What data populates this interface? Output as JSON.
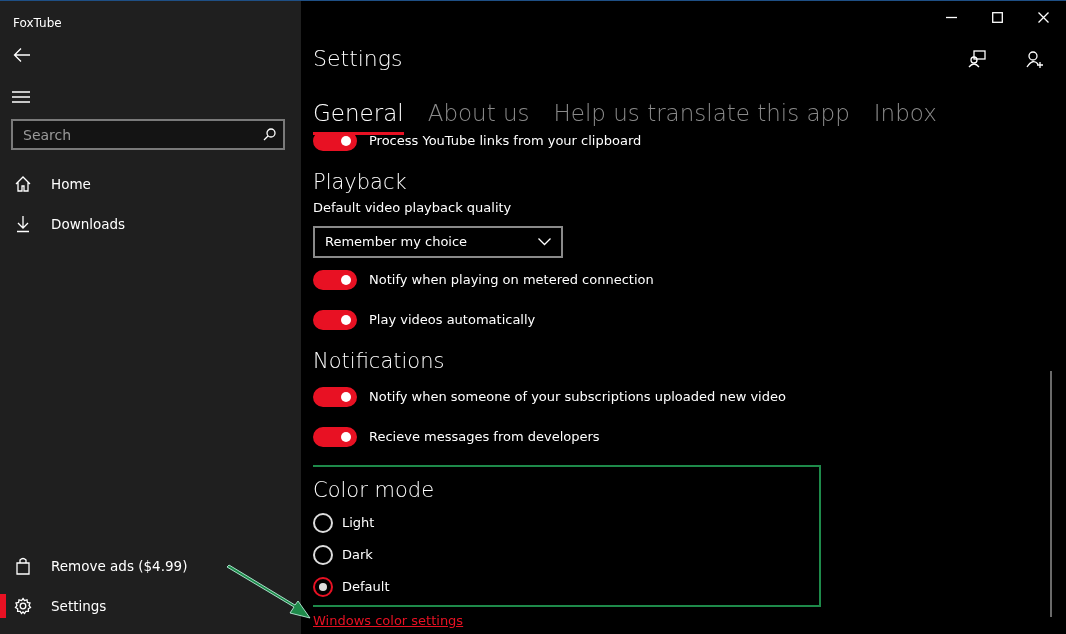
{
  "window": {
    "title": "FoxTube"
  },
  "sidebar": {
    "search": {
      "placeholder": "Search"
    },
    "items": [
      {
        "label": "Home",
        "selected": false
      },
      {
        "label": "Downloads",
        "selected": false
      }
    ],
    "footer_items": [
      {
        "label": "Remove ads ($4.99)",
        "selected": false
      },
      {
        "label": "Settings",
        "selected": true
      }
    ]
  },
  "page": {
    "title": "Settings",
    "tabs": [
      {
        "label": "General",
        "selected": true
      },
      {
        "label": "About us",
        "selected": false
      },
      {
        "label": "Help us translate this app",
        "selected": false
      },
      {
        "label": "Inbox",
        "selected": false
      }
    ],
    "top_toggle": {
      "label": "Process YouTube links from your clipboard",
      "on": true
    },
    "sections": [
      {
        "title": "Playback",
        "items": [
          {
            "kind": "dropdown",
            "label": "Default video playback quality",
            "value": "Remember my choice"
          },
          {
            "kind": "toggle",
            "label": "Notify when playing on metered connection",
            "on": true
          },
          {
            "kind": "toggle",
            "label": "Play videos automatically",
            "on": true
          }
        ]
      },
      {
        "title": "Notifications",
        "items": [
          {
            "kind": "toggle",
            "label": "Notify when someone of your subscriptions uploaded new video",
            "on": true
          },
          {
            "kind": "toggle",
            "label": "Recieve messages from developers",
            "on": true
          }
        ]
      },
      {
        "title": "Color mode",
        "highlighted": true,
        "items": [
          {
            "kind": "radio",
            "label": "Light",
            "selected": false
          },
          {
            "kind": "radio",
            "label": "Dark",
            "selected": false
          },
          {
            "kind": "radio",
            "label": "Default",
            "selected": true
          }
        ]
      }
    ],
    "link": "Windows color settings"
  }
}
